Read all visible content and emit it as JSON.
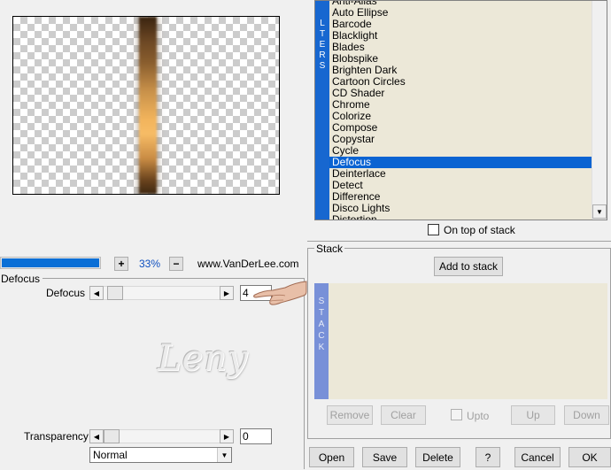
{
  "preview": {
    "zoom": "33%",
    "website": "www.VanDerLee.com",
    "zoom_in": "+",
    "zoom_out": "−"
  },
  "filters": {
    "strip_letters": [
      "L",
      "T",
      "E",
      "R",
      "S"
    ],
    "items": [
      "Anti-Alias",
      "Auto Ellipse",
      "Barcode",
      "Blacklight",
      "Blades",
      "Blobspike",
      "Brighten Dark",
      "Cartoon Circles",
      "CD Shader",
      "Chrome",
      "Colorize",
      "Compose",
      "Copystar",
      "Cycle",
      "Defocus",
      "Deinterlace",
      "Detect",
      "Difference",
      "Disco Lights",
      "Distortion"
    ],
    "selected": "Defocus",
    "on_top_label": "On top of stack"
  },
  "params": {
    "group_label": "Defocus",
    "defocus_label": "Defocus",
    "defocus_value": "4",
    "transparency_label": "Transparency",
    "transparency_value": "0",
    "blend_mode": "Normal"
  },
  "watermark": "Leny",
  "stack": {
    "title": "Stack",
    "add_label": "Add to stack",
    "strip_letters": [
      "S",
      "T",
      "A",
      "C",
      "K"
    ],
    "remove_label": "Remove",
    "clear_label": "Clear",
    "upto_label": "Upto",
    "up_label": "Up",
    "down_label": "Down"
  },
  "footer": {
    "open": "Open",
    "save": "Save",
    "delete": "Delete",
    "help": "?",
    "cancel": "Cancel",
    "ok": "OK"
  }
}
